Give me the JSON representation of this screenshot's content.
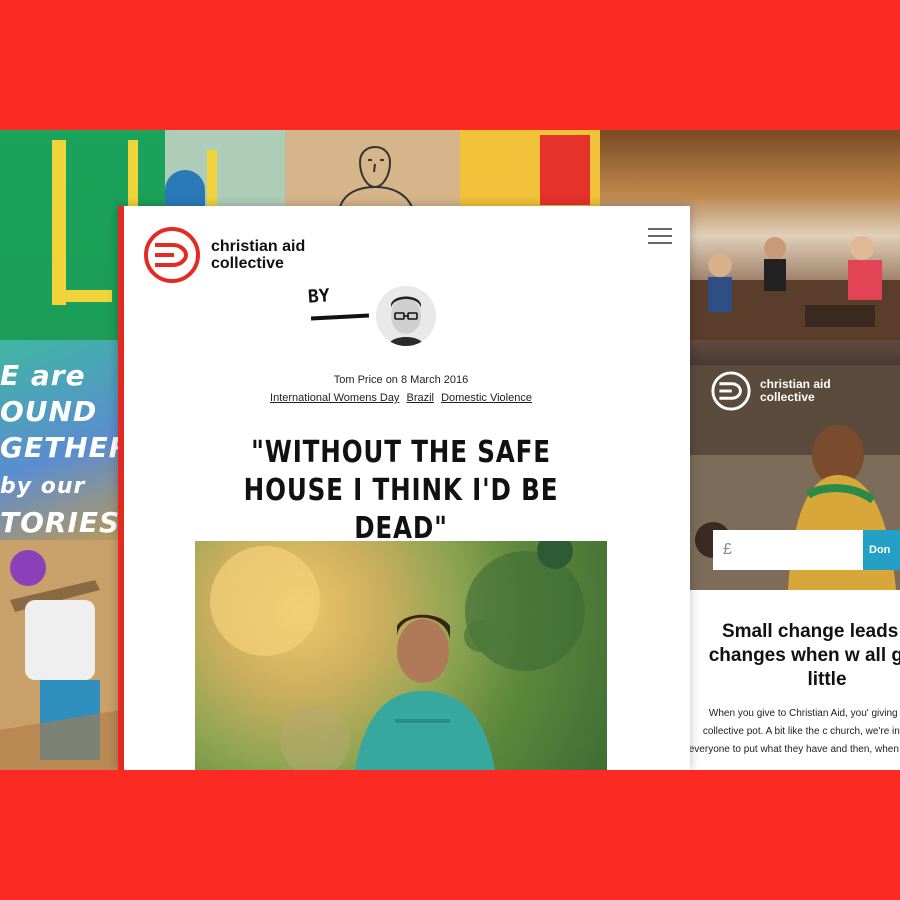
{
  "brand": {
    "name_line1": "christian aid",
    "name_line2": "collective",
    "red": "#fb2a22",
    "accent": "#23a0c4"
  },
  "poster": {
    "slogan_lines": [
      "E are",
      "OUND",
      "GETHER",
      "by our",
      "TORIES"
    ]
  },
  "article": {
    "by_label": "BY",
    "meta": "Tom Price on 8 March 2016",
    "tags": [
      "International Womens Day",
      "Brazil",
      "Domestic Violence"
    ],
    "title": "\"WITHOUT THE SAFE HOUSE I THINK I'D BE DEAD\"",
    "menu_icon": "hamburger-icon"
  },
  "campaign": {
    "currency": "£",
    "donate_label": "Don",
    "heading": "Small change leads big changes when w all give a little",
    "body": "When you give to Christian Aid, you' giving to a collective pot. A bit like the c church, we're inviting everyone to put what they have and then, when someon"
  }
}
